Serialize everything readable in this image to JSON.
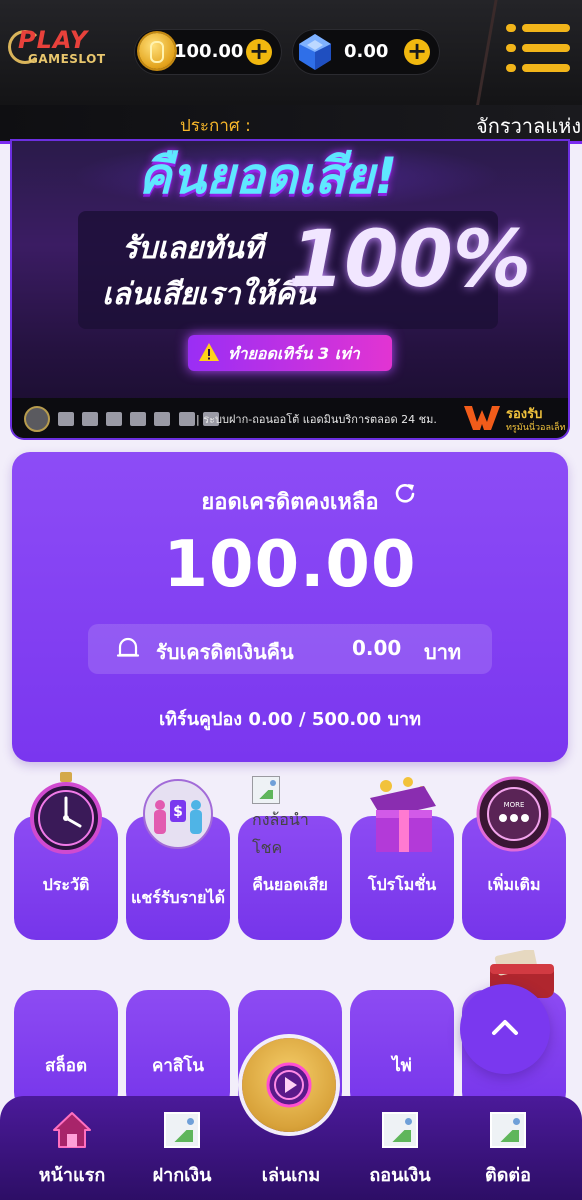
{
  "header": {
    "logo": {
      "top": "PLAY",
      "bottom": "GAMESLOT"
    },
    "coin_balance": "100.00",
    "gem_balance": "0.00",
    "plus_symbol": "+"
  },
  "marquee": {
    "label": "ประกาศ :",
    "text": "จักรวาลแห่ง"
  },
  "banner": {
    "title": "คืนยอดเสีย!",
    "line1": "รับเลยทันที",
    "line2": "เล่นเสียเราให้คืน",
    "percent": "100%",
    "button": "ทำยอดเทิร์น 3 เท่า",
    "strip_text": "| ระบบฝาก-ถอนออโต้ แอดมินบริการตลอด 24 ชม.",
    "wallet_line1": "รองรับ",
    "wallet_line2": "ทรูมันนี่วอลเล็ท"
  },
  "credit": {
    "label": "ยอดเครดิตคงเหลือ",
    "amount": "100.00",
    "cashback_label": "รับเครดิตเงินคืน",
    "cashback_value": "0.00",
    "cashback_unit": "บาท",
    "turnover": "เทิร์นคูปอง 0.00 / 500.00 บาท"
  },
  "menu": [
    {
      "label": "ประวัติ",
      "icon": "stopwatch-icon"
    },
    {
      "label": "แชร์รับรายได้",
      "icon": "share-income-icon"
    },
    {
      "label": "คืนยอดเสีย",
      "icon": "broken-image-icon",
      "alt": "กงล้อนำโชค"
    },
    {
      "label": "โปรโมชั่น",
      "icon": "gift-box-icon"
    },
    {
      "label": "เพิ่มเติม",
      "icon": "more-icon",
      "badge": "MORE"
    }
  ],
  "games": [
    {
      "label": "สล็อต"
    },
    {
      "label": "คาสิโน"
    },
    {
      "label": ""
    },
    {
      "label": "ไพ่"
    },
    {
      "label": ""
    }
  ],
  "bottom_nav": [
    {
      "label": "หน้าแรก",
      "icon": "home-icon"
    },
    {
      "label": "ฝากเงิน",
      "icon": "deposit-icon"
    },
    {
      "label": "เล่นเกม",
      "icon": "play-icon"
    },
    {
      "label": "ถอนเงิน",
      "icon": "withdraw-icon"
    },
    {
      "label": "ติดต่อ",
      "icon": "contact-icon"
    }
  ],
  "colors": {
    "brand_purple": "#7a38ef",
    "gold": "#f2b51a",
    "header_bg": "#18181b"
  }
}
